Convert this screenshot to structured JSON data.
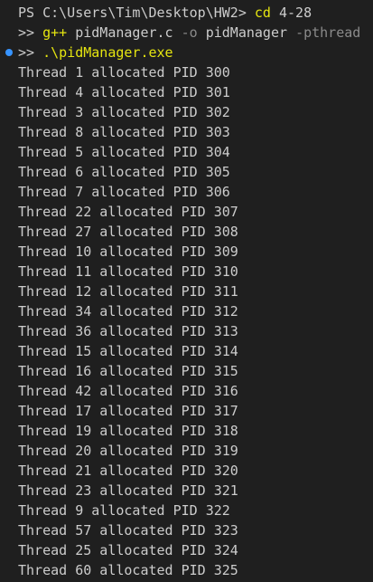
{
  "colors": {
    "background": "#1f1f1f",
    "text": "#cccccc",
    "command": "#e5e510",
    "flag": "#8a8a8a",
    "marker": "#3794ff"
  },
  "prompt": {
    "ps": "PS C:\\Users\\Tim\\Desktop\\HW2> ",
    "cd_cmd": "cd",
    "cd_arg": " 4-28",
    "cont": ">> ",
    "gpp_cmd": "g++",
    "gpp_src": " pidManager.c ",
    "gpp_flag_o": "-o",
    "gpp_out": " pidManager ",
    "gpp_flag_pthread": "-pthread",
    "run_cmd": ".\\pidManager.exe",
    "marker_icon": "circle-dot-icon"
  },
  "output": [
    "Thread 1 allocated PID 300",
    "Thread 4 allocated PID 301",
    "Thread 3 allocated PID 302",
    "Thread 8 allocated PID 303",
    "Thread 5 allocated PID 304",
    "Thread 6 allocated PID 305",
    "Thread 7 allocated PID 306",
    "Thread 22 allocated PID 307",
    "Thread 27 allocated PID 308",
    "Thread 10 allocated PID 309",
    "Thread 11 allocated PID 310",
    "Thread 12 allocated PID 311",
    "Thread 34 allocated PID 312",
    "Thread 36 allocated PID 313",
    "Thread 15 allocated PID 314",
    "Thread 16 allocated PID 315",
    "Thread 42 allocated PID 316",
    "Thread 17 allocated PID 317",
    "Thread 19 allocated PID 318",
    "Thread 20 allocated PID 319",
    "Thread 21 allocated PID 320",
    "Thread 23 allocated PID 321",
    "Thread 9 allocated PID 322",
    "Thread 57 allocated PID 323",
    "Thread 25 allocated PID 324",
    "Thread 60 allocated PID 325"
  ]
}
